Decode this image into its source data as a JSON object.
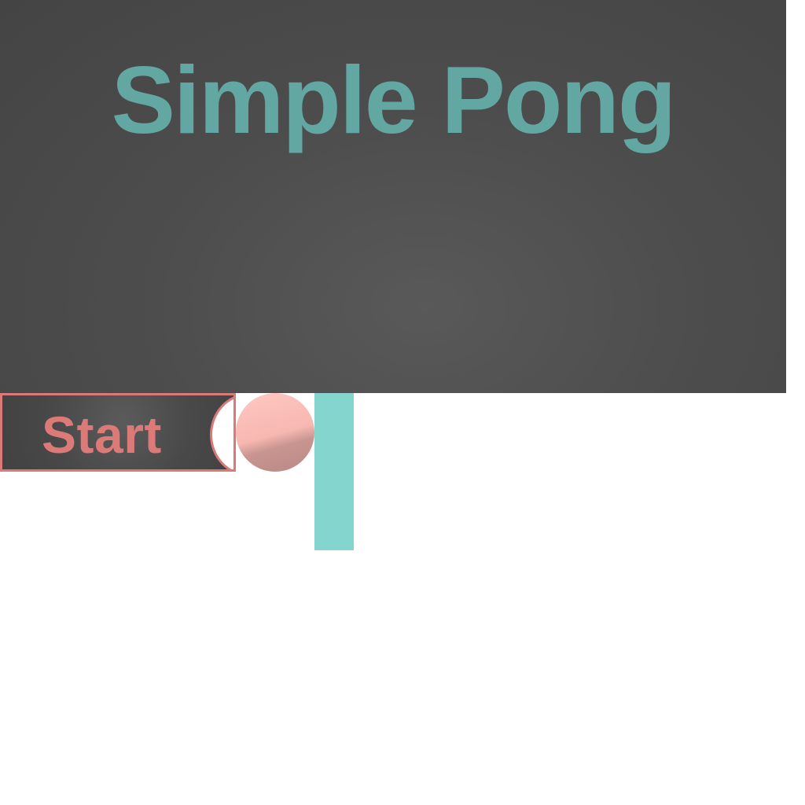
{
  "game": {
    "title": "Simple Pong"
  },
  "controls": {
    "start_label": "Start"
  },
  "colors": {
    "title": "#63a7a2",
    "start_text": "#dc7a77",
    "start_border": "#d97a78",
    "ball": "#f7b8b1",
    "paddle": "#85d5cf",
    "screen_background": "#4d4d4d"
  }
}
